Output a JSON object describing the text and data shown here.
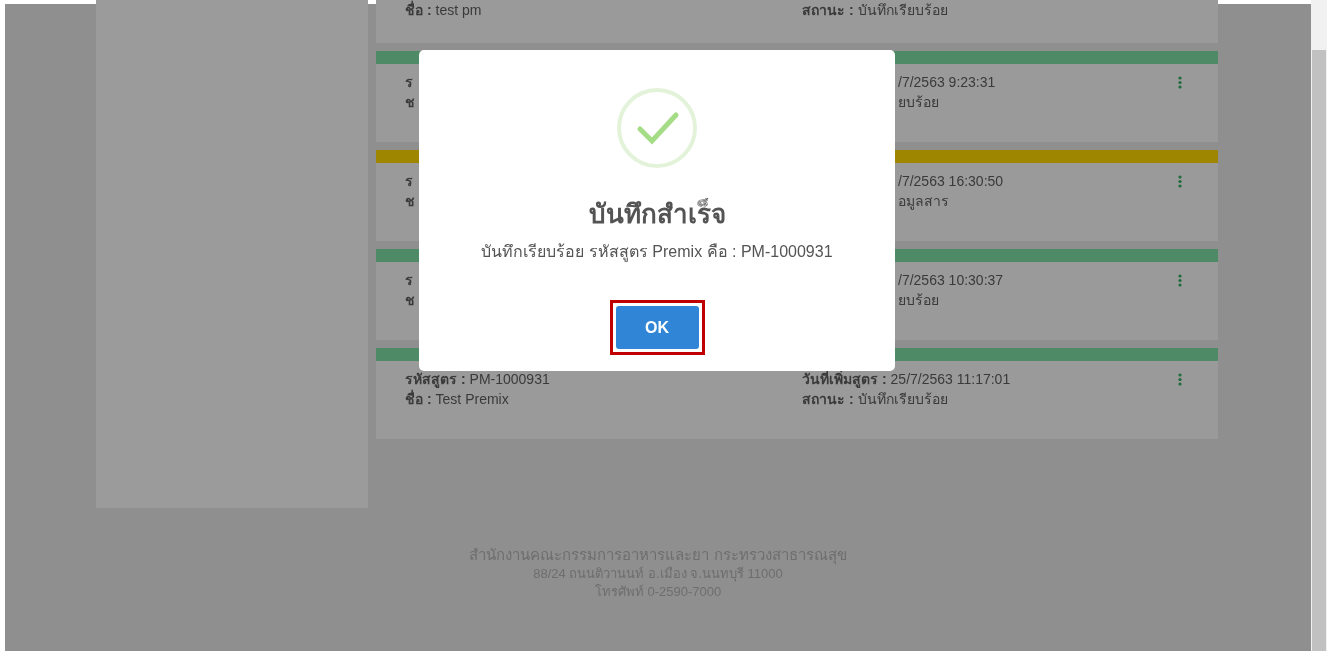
{
  "cards": [
    {
      "kind": "top",
      "name_label": "ชื่อ :",
      "name": "test pm",
      "status_label": "สถานะ :",
      "status": "บันทึกเรียบร้อย"
    },
    {
      "kind": "partial",
      "color": "#4e8a66",
      "code_label": "ร",
      "name_label": "ช",
      "date": "/7/2563 9:23:31",
      "status": "ยบร้อย"
    },
    {
      "kind": "partial",
      "color": "#9e8600",
      "code_label": "ร",
      "name_label": "ช",
      "date": "/7/2563 16:30:50",
      "status": "อมูลสาร"
    },
    {
      "kind": "partial",
      "color": "#4e8a66",
      "code_label": "ร",
      "name_label": "ช",
      "date": "/7/2563 10:30:37",
      "status": "ยบร้อย"
    },
    {
      "kind": "full",
      "color": "#4e8a66",
      "code_label": "รหัสสูตร :",
      "code": "PM-1000931",
      "name_label": "ชื่อ :",
      "name": "Test Premix",
      "date_label": "วันที่เพิ่มสูตร :",
      "date": "25/7/2563 11:17:01",
      "status_label": "สถานะ :",
      "status": "บันทึกเรียบร้อย"
    }
  ],
  "footer": [
    "สำนักงานคณะกรรมการอาหารและยา กระทรวงสาธารณสุข",
    "88/24 ถนนติวานนท์ อ.เมือง จ.นนทบุรี 11000",
    "โทรศัพท์ 0-2590-7000"
  ],
  "dialog": {
    "title": "บันทึกสำเร็จ",
    "message": "บันทึกเรียบร้อย รหัสสูตร Premix คือ : PM-1000931",
    "button": "OK",
    "button_focused": true
  }
}
